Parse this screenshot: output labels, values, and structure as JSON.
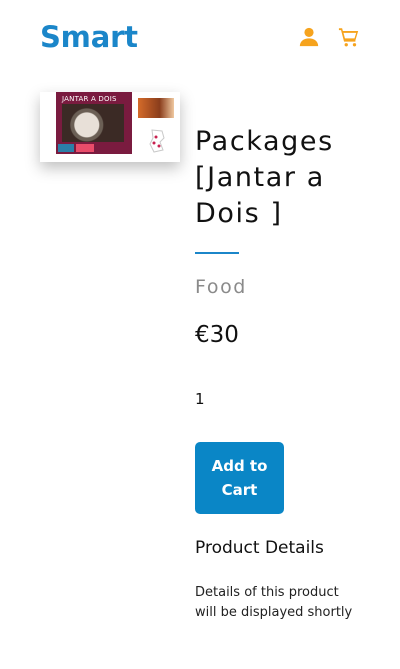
{
  "header": {
    "brand": "Smart",
    "icons": [
      "user-icon",
      "cart-icon"
    ],
    "icon_color": "#f6a31d",
    "brand_color": "#1b86c9"
  },
  "product": {
    "image_label": "JANTAR A DOIS",
    "title": "Packages [Jantar a Dois ]",
    "category": "Food",
    "price": "€30",
    "quantity": "1",
    "add_to_cart_label": "Add to Cart",
    "details_heading": "Product Details",
    "details_text": "Details of this product will be displayed shortly"
  },
  "colors": {
    "accent": "#0a86c6",
    "divider": "#1b86c9",
    "muted_text": "#8a8a8a"
  }
}
